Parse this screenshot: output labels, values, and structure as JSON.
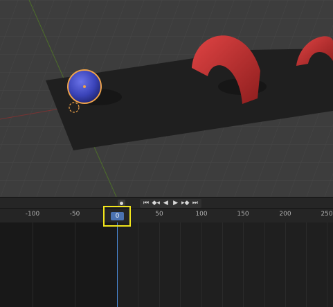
{
  "viewport": {
    "objects": [
      {
        "name": "sphere",
        "color": "#3a43b8",
        "selected": true,
        "selection_color": "#f0a34a"
      },
      {
        "name": "arch-1",
        "color": "#c83232"
      },
      {
        "name": "arch-2",
        "color": "#c83232"
      },
      {
        "name": "ground-plane",
        "color": "#1f1f1f"
      }
    ],
    "background": "#3d3d3d",
    "axis_x_color": "#a03a3a",
    "axis_y_color": "#5f8a2e"
  },
  "timeline": {
    "current_frame": "0",
    "ruler_labels": [
      "-100",
      "-50",
      "0",
      "50",
      "100",
      "150",
      "200",
      "250"
    ],
    "playback_controls": [
      {
        "name": "jump-to-start-icon",
        "glyph": "⏮"
      },
      {
        "name": "prev-keyframe-icon",
        "glyph": "◆◂"
      },
      {
        "name": "play-reverse-icon",
        "glyph": "◀"
      },
      {
        "name": "play-icon",
        "glyph": "▶"
      },
      {
        "name": "next-keyframe-icon",
        "glyph": "▸◆"
      },
      {
        "name": "jump-to-end-icon",
        "glyph": "⏭"
      }
    ],
    "highlight_color": "#f2e51b",
    "frame_indicator_color": "#4b72b0"
  }
}
